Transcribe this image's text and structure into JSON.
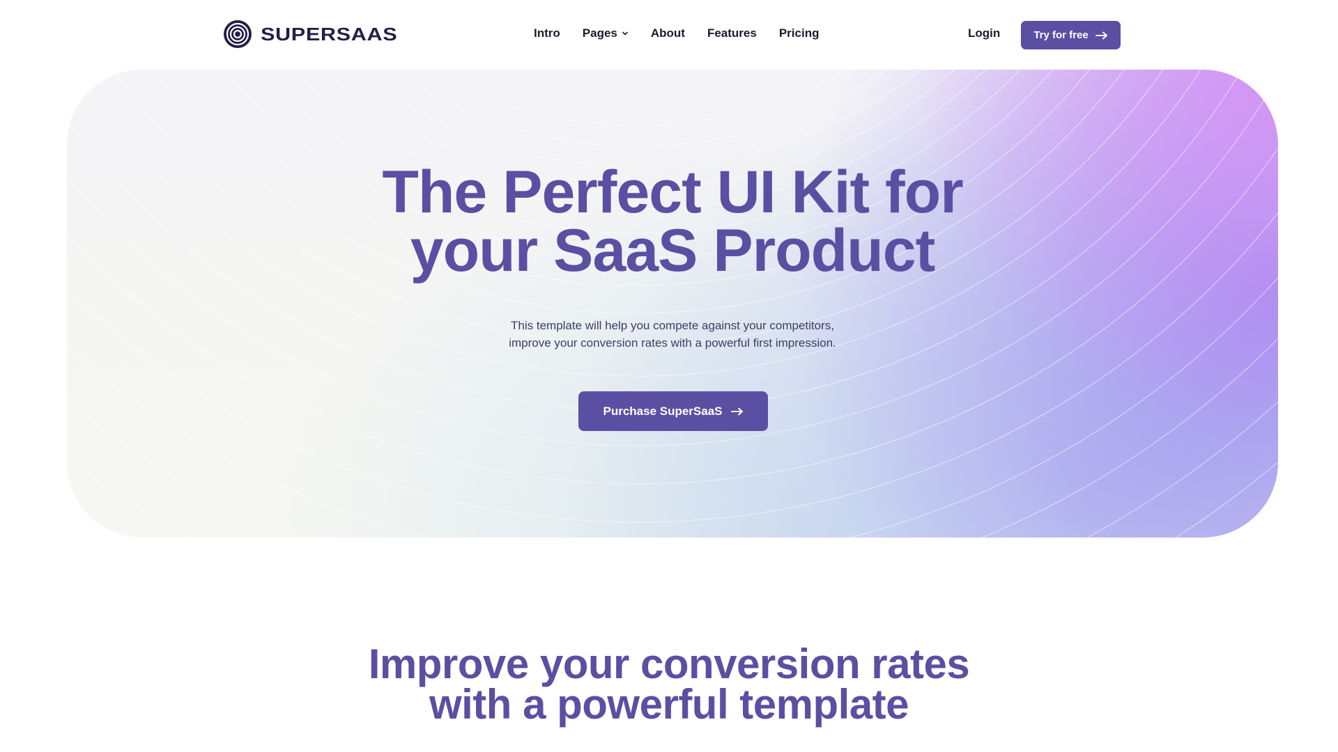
{
  "brand": {
    "name": "SUPERSAAS",
    "primary_color": "#5b4fa3",
    "dark_color": "#232047",
    "logo_icon": "concentric-circles-logo-icon"
  },
  "nav": {
    "items": [
      {
        "label": "Intro"
      },
      {
        "label": "Pages",
        "icon": "chevron-down-icon"
      },
      {
        "label": "About"
      },
      {
        "label": "Features"
      },
      {
        "label": "Pricing"
      }
    ],
    "login_label": "Login",
    "try_button": {
      "label": "Try for free",
      "icon": "arrow-right-icon"
    }
  },
  "hero": {
    "title_lines": [
      "The Perfect UI Kit for",
      "your SaaS Product"
    ],
    "subtitle_lines": [
      "This template will help you compete against your competitors,",
      "improve your conversion rates with a powerful first impression."
    ],
    "cta": {
      "label": "Purchase SuperSaaS",
      "icon": "arrow-right-icon"
    },
    "gradient_colors": [
      "#f4f3f7",
      "#f6f7f2",
      "#cde1ee",
      "#9682f0",
      "#d78cf5"
    ]
  },
  "section": {
    "title_lines": [
      "Improve your conversion rates",
      "with a powerful template"
    ]
  }
}
